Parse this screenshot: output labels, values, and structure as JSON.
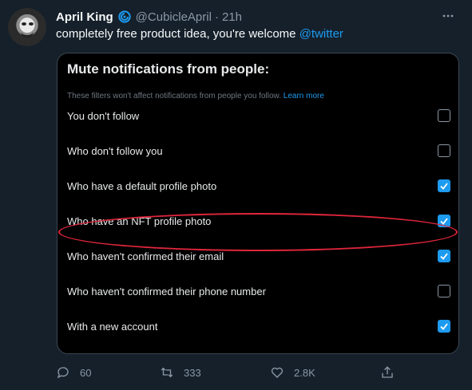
{
  "tweet": {
    "author_name": "April King",
    "handle": "@CubicleApril",
    "separator": "·",
    "time": "21h",
    "text": "completely free product idea, you're welcome",
    "mention": "@twitter"
  },
  "card": {
    "title": "Mute notifications from people:",
    "subtitle": "These filters won't affect notifications from people you follow.",
    "learn_more": "Learn more",
    "options": [
      {
        "label": "You don't follow",
        "checked": false
      },
      {
        "label": "Who don't follow you",
        "checked": false
      },
      {
        "label": "Who have a default profile photo",
        "checked": true
      },
      {
        "label": "Who have an NFT profile photo",
        "checked": true
      },
      {
        "label": "Who haven't confirmed their email",
        "checked": true
      },
      {
        "label": "Who haven't confirmed their phone number",
        "checked": false
      },
      {
        "label": "With a new account",
        "checked": true
      }
    ]
  },
  "actions": {
    "replies": "60",
    "retweets": "333",
    "likes": "2.8K"
  },
  "colors": {
    "background": "#15202b",
    "accent": "#1d9bf0",
    "highlight_circle": "#e0263b"
  },
  "icons": {
    "verified": "verified-badge-icon",
    "more": "more-icon",
    "reply": "reply-icon",
    "retweet": "retweet-icon",
    "like": "heart-icon",
    "share": "share-icon",
    "check": "check-icon"
  }
}
